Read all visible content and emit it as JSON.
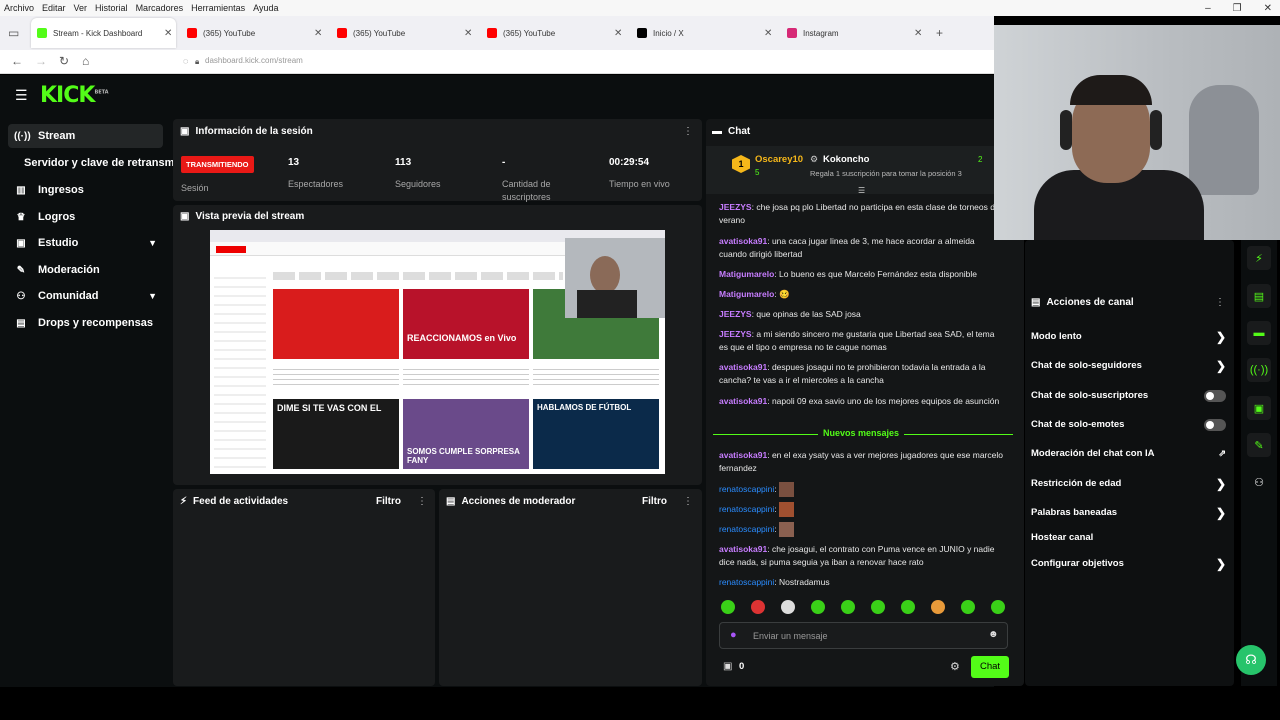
{
  "browser": {
    "menu": [
      "Archivo",
      "Editar",
      "Ver",
      "Historial",
      "Marcadores",
      "Herramientas",
      "Ayuda"
    ],
    "tabs": [
      {
        "title": "Stream - Kick Dashboard",
        "favicon_color": "#53fc18"
      },
      {
        "title": "(365) YouTube",
        "favicon_color": "#ff0000"
      },
      {
        "title": "(365) YouTube",
        "favicon_color": "#ff0000"
      },
      {
        "title": "(365) YouTube",
        "favicon_color": "#ff0000"
      },
      {
        "title": "Inicio / X",
        "favicon_color": "#000000"
      },
      {
        "title": "Instagram",
        "favicon_color": "#d62976"
      }
    ],
    "url": "dashboard.kick.com/stream"
  },
  "kick": {
    "logo": "KICK",
    "beta": "BETA",
    "accent": "#53fc18",
    "sidebar": [
      {
        "label": "Stream",
        "icon": "broadcast-icon"
      },
      {
        "label": "Servidor y clave de retransmisión",
        "icon": ""
      },
      {
        "label": "Ingresos",
        "icon": "chart-icon"
      },
      {
        "label": "Logros",
        "icon": "trophy-icon"
      },
      {
        "label": "Estudio",
        "icon": "studio-icon"
      },
      {
        "label": "Moderación",
        "icon": "wrench-icon"
      },
      {
        "label": "Comunidad",
        "icon": "community-icon"
      },
      {
        "label": "Drops y recompensas",
        "icon": "gift-icon"
      }
    ],
    "session": {
      "title": "Información de la sesión",
      "status": "TRANSMITIENDO",
      "session_label": "Sesión",
      "stats": [
        {
          "value": "13",
          "label": "Espectadores"
        },
        {
          "value": "113",
          "label": "Seguidores"
        },
        {
          "value": "-",
          "label": "Cantidad de suscriptores"
        },
        {
          "value": "00:29:54",
          "label": "Tiempo en vivo"
        }
      ]
    },
    "preview_title": "Vista previa del stream",
    "preview_banners": [
      "REACCIONAMOS en Vivo",
      "DIME SI TE VAS CON EL",
      "SOMOS CUMPLE SORPRESA FANY",
      "HABLAMOS DE FÚTBOL"
    ],
    "feed": {
      "title": "Feed de actividades",
      "filter": "Filtro"
    },
    "modactions": {
      "title": "Acciones de moderador",
      "filter": "Filtro"
    },
    "chat": {
      "title": "Chat",
      "pinned_user1": "Oscarey10",
      "pinned_user2": "Kokoncho",
      "pinned_sub": "Regala 1 suscripción para tomar la posición 3",
      "pinned_count": "5",
      "pinned_count2": "2",
      "rank": "1",
      "new_messages": "Nuevos mensajes",
      "messages": [
        {
          "user": "JEEZYS",
          "text": "che josa pq plo Libertad no participa en esta clase de torneos de verano"
        },
        {
          "user": "avatisoka91",
          "text": "una caca jugar linea de 3, me hace acordar a almeida cuando dirigió libertad"
        },
        {
          "user": "Matigumarelo",
          "text": "Lo bueno es que Marcelo Fernández esta disponible"
        },
        {
          "user": "Matigumarelo",
          "text": "🥴"
        },
        {
          "user": "JEEZYS",
          "text": "que opinas de las SAD josa"
        },
        {
          "user": "JEEZYS",
          "text": "a mi siendo sincero me gustaria que Libertad sea SAD, el tema es que el tipo o empresa no te cague nomas"
        },
        {
          "user": "avatisoka91",
          "text": "despues josagui no te prohibieron todavia la entrada a la cancha? te vas a ir el miercoles a la cancha"
        },
        {
          "user": "avatisoka91",
          "text": "napoli 09 exa savio uno de los mejores equipos de asunción"
        }
      ],
      "new": [
        {
          "user": "avatisoka91",
          "text": "en el exa ysaty vas a ver mejores jugadores que ese marcelo fernandez"
        },
        {
          "user": "renatoscappini",
          "text": ""
        },
        {
          "user": "renatoscappini",
          "text": ""
        },
        {
          "user": "renatoscappini",
          "text": ""
        },
        {
          "user": "avatisoka91",
          "text": "che josagui, el contrato con Puma vence en JUNIO y nadie dice nada, si puma seguia ya iban a renovar hace rato"
        },
        {
          "user": "renatoscappini",
          "text": "Nostradamus"
        }
      ],
      "placeholder": "Enviar un mensaje",
      "counter": "0",
      "send": "Chat"
    },
    "channel_actions": {
      "title": "Acciones de canal",
      "items": [
        {
          "label": "Modo lento",
          "control": "arrow"
        },
        {
          "label": "Chat de solo-seguidores",
          "control": "arrow"
        },
        {
          "label": "Chat de solo-suscriptores",
          "control": "toggle",
          "on": false
        },
        {
          "label": "Chat de solo-emotes",
          "control": "toggle",
          "on": false
        },
        {
          "label": "Moderación del chat con IA",
          "control": "external"
        },
        {
          "label": "Restricción de edad",
          "control": "arrow"
        },
        {
          "label": "Palabras baneadas",
          "control": "arrow"
        },
        {
          "label": "Hostear canal",
          "control": "none"
        },
        {
          "label": "Configurar objetivos",
          "control": "arrow"
        }
      ]
    }
  }
}
